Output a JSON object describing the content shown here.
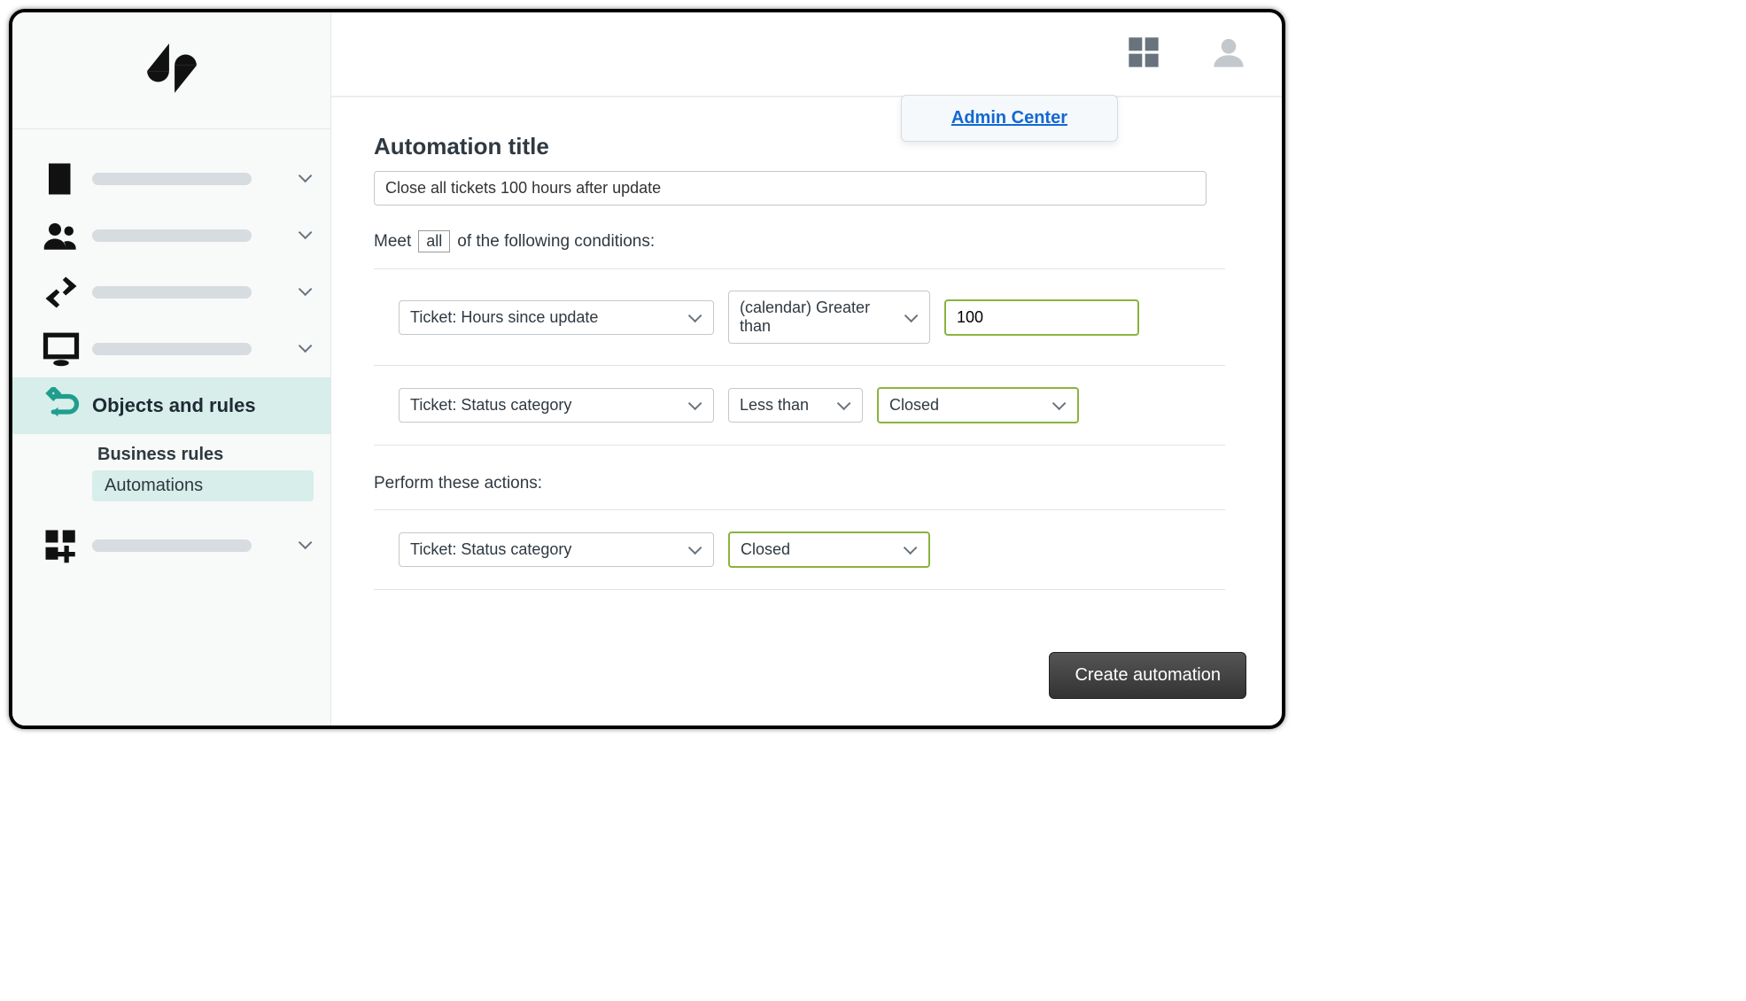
{
  "sidebar": {
    "active_label": "Objects and rules",
    "subnav": {
      "business_rules": "Business rules",
      "automations": "Automations"
    }
  },
  "topbar": {
    "admin_center_link": "Admin Center"
  },
  "form": {
    "title_label": "Automation title",
    "title_value": "Close all tickets 100 hours after update",
    "cond_prefix": "Meet",
    "cond_all": "all",
    "cond_suffix": "of the following conditions:",
    "conditions": [
      {
        "field": "Ticket: Hours since update",
        "operator": "(calendar) Greater than",
        "value": "100",
        "value_type": "text"
      },
      {
        "field": "Ticket: Status category",
        "operator": "Less than",
        "value": "Closed",
        "value_type": "select"
      }
    ],
    "actions_label": "Perform these actions:",
    "actions": [
      {
        "field": "Ticket: Status category",
        "value": "Closed"
      }
    ],
    "create_button": "Create automation"
  }
}
